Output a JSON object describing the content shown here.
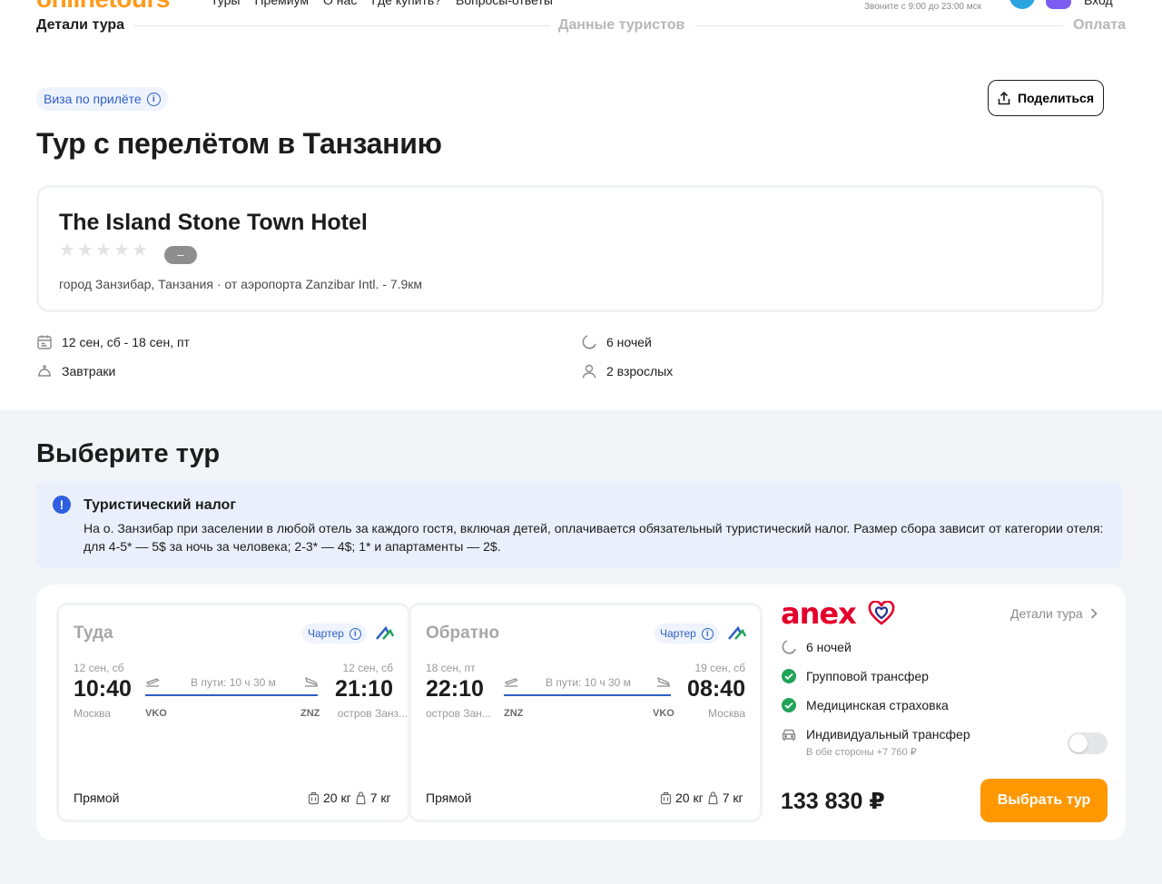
{
  "header": {
    "logo": "onlinetours",
    "nav": [
      "Туры",
      "Премиум",
      "О нас",
      "Где купить?",
      "Вопросы-ответы"
    ],
    "call_hint": "Звоните с 9:00 до 23:00 мск",
    "login": "Вход"
  },
  "stepper": {
    "steps": [
      "Детали тура",
      "Данные туристов",
      "Оплата"
    ],
    "active": 0
  },
  "visa_badge": "Виза по прилёте",
  "share_label": "Поделиться",
  "title": "Тур с перелётом в Танзанию",
  "hotel": {
    "name": "The Island Stone Town Hotel",
    "stars": 0,
    "rating": "–",
    "location": "город Занзибар, Танзания · от аэропорта Zanzibar Intl. - 7.9км"
  },
  "meta": {
    "dates": "12 сен, сб - 18 сен, пт",
    "nights": "6 ночей",
    "meals": "Завтраки",
    "guests": "2 взрослых"
  },
  "choose_title": "Выберите тур",
  "notice": {
    "title": "Туристический налог",
    "text": "На о. Занзибар при заселении в любой отель за каждого гостя, включая детей, оплачивается обязательный туристический налог. Размер сбора зависит от категории отеля: для 4-5* — 5$ за ночь за человека; 2-3* — 4$; 1* и апартаменты — 2$."
  },
  "flights": [
    {
      "direction": "Туда",
      "charter": "Чартер",
      "dep_date": "12 сен, сб",
      "dep_time": "10:40",
      "dep_city": "Москва",
      "dep_code": "VKO",
      "duration": "В пути: 10 ч 30 м",
      "arr_date": "12 сен, сб",
      "arr_time": "21:10",
      "arr_city": "остров Занз...",
      "arr_code": "ZNZ",
      "type": "Прямой",
      "baggage": "20 кг",
      "hand": "7 кг"
    },
    {
      "direction": "Обратно",
      "charter": "Чартер",
      "dep_date": "18 сен, пт",
      "dep_time": "22:10",
      "dep_city": "остров Зан...",
      "dep_code": "ZNZ",
      "duration": "В пути: 10 ч 30 м",
      "arr_date": "19 сен, сб",
      "arr_time": "08:40",
      "arr_city": "Москва",
      "arr_code": "VKO",
      "type": "Прямой",
      "baggage": "20 кг",
      "hand": "7 кг"
    }
  ],
  "operator": {
    "name": "anex",
    "details_link": "Детали тура",
    "nights": "6 ночей",
    "included": [
      "Групповой трансфер",
      "Медицинская страховка"
    ],
    "option": {
      "label": "Индивидуальный трансфер",
      "sub": "В обе стороны +7 760 ₽",
      "enabled": false
    },
    "price": "133 830 ₽",
    "cta": "Выбрать тур"
  },
  "colors": {
    "brand_orange": "#ff9800",
    "accent_blue": "#2f5fc6",
    "anex_red": "#e4002b",
    "check_green": "#21a35a"
  }
}
